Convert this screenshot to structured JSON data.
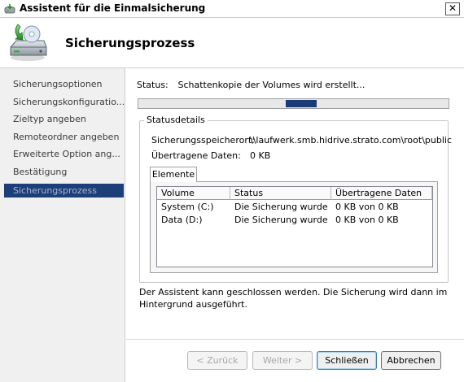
{
  "window": {
    "title": "Assistent für die Einmalsicherung",
    "close_glyph": "✕"
  },
  "header": {
    "title": "Sicherungsprozess",
    "icon": "backup-drive-icon"
  },
  "sidebar": {
    "items": [
      {
        "label": "Sicherungsoptionen",
        "active": false
      },
      {
        "label": "Sicherungskonfiguratio...",
        "active": false
      },
      {
        "label": "Zieltyp angeben",
        "active": false
      },
      {
        "label": "Remoteordner angeben",
        "active": false
      },
      {
        "label": "Erweiterte Option ang...",
        "active": false
      },
      {
        "label": "Bestätigung",
        "active": false
      },
      {
        "label": "Sicherungsprozess",
        "active": true
      }
    ]
  },
  "status": {
    "label": "Status:",
    "value": "Schattenkopie der Volumes wird erstellt..."
  },
  "progress": {
    "mode": "marquee",
    "indicator_start": 0.475,
    "indicator_end": 0.575
  },
  "details": {
    "legend": "Statusdetails",
    "location_label": "Sicherungsspeicherort:",
    "location_value": "\\\\laufwerk.smb.hidrive.strato.com\\root\\public",
    "transferred_label": "Übertragene Daten:",
    "transferred_value": "0 KB"
  },
  "tabs": [
    {
      "label": "Elemente",
      "selected": true
    }
  ],
  "list": {
    "columns": [
      "Volume",
      "Status",
      "Übertragene Daten"
    ],
    "rows": [
      [
        "System (C:)",
        "Die Sicherung wurde ...",
        "0 KB von 0 KB"
      ],
      [
        "Data (D:)",
        "Die Sicherung wurde ...",
        "0 KB von 0 KB"
      ]
    ]
  },
  "info_text": "Der Assistent kann geschlossen werden. Die Sicherung wird dann im Hintergrund ausgeführt.",
  "buttons": {
    "back": "< Zurück",
    "next": "Weiter >",
    "close": "Schließen",
    "cancel": "Abbrechen"
  },
  "colors": {
    "selection": "#1c3f7a",
    "progress_fill": "#1a3a78",
    "sidebar_bg": "#f0f0f0"
  }
}
